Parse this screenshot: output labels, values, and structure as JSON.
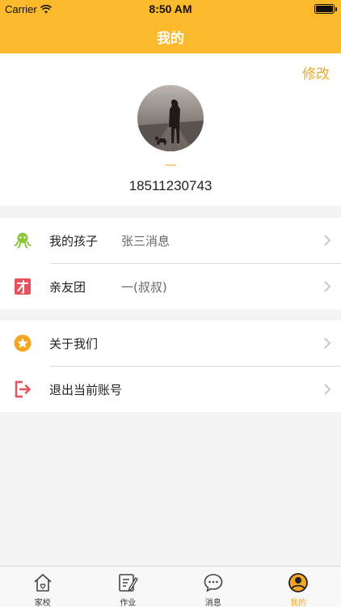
{
  "status_bar": {
    "carrier": "Carrier",
    "time": "8:50 AM"
  },
  "nav": {
    "title": "我的"
  },
  "profile": {
    "edit_label": "修改",
    "nickname": "—",
    "phone": "18511230743"
  },
  "menu": {
    "group1": [
      {
        "icon": "child-octopus-icon",
        "label": "我的孩子",
        "value": "张三消息"
      },
      {
        "icon": "family-group-icon",
        "label": "亲友团",
        "value": "一(叔叔)"
      }
    ],
    "group2": [
      {
        "icon": "star-icon",
        "label": "关于我们"
      },
      {
        "icon": "logout-icon",
        "label": "退出当前账号"
      }
    ]
  },
  "tabbar": {
    "tabs": [
      {
        "icon": "home-icon",
        "label": "家校"
      },
      {
        "icon": "homework-icon",
        "label": "作业"
      },
      {
        "icon": "message-icon",
        "label": "消息"
      },
      {
        "icon": "user-icon",
        "label": "我的"
      }
    ],
    "active_index": 3
  },
  "colors": {
    "brand": "#fbb92c",
    "accent": "#f5a623",
    "child_icon": "#8cc63f",
    "family_icon": "#e8505b",
    "logout_icon": "#e8505b"
  }
}
